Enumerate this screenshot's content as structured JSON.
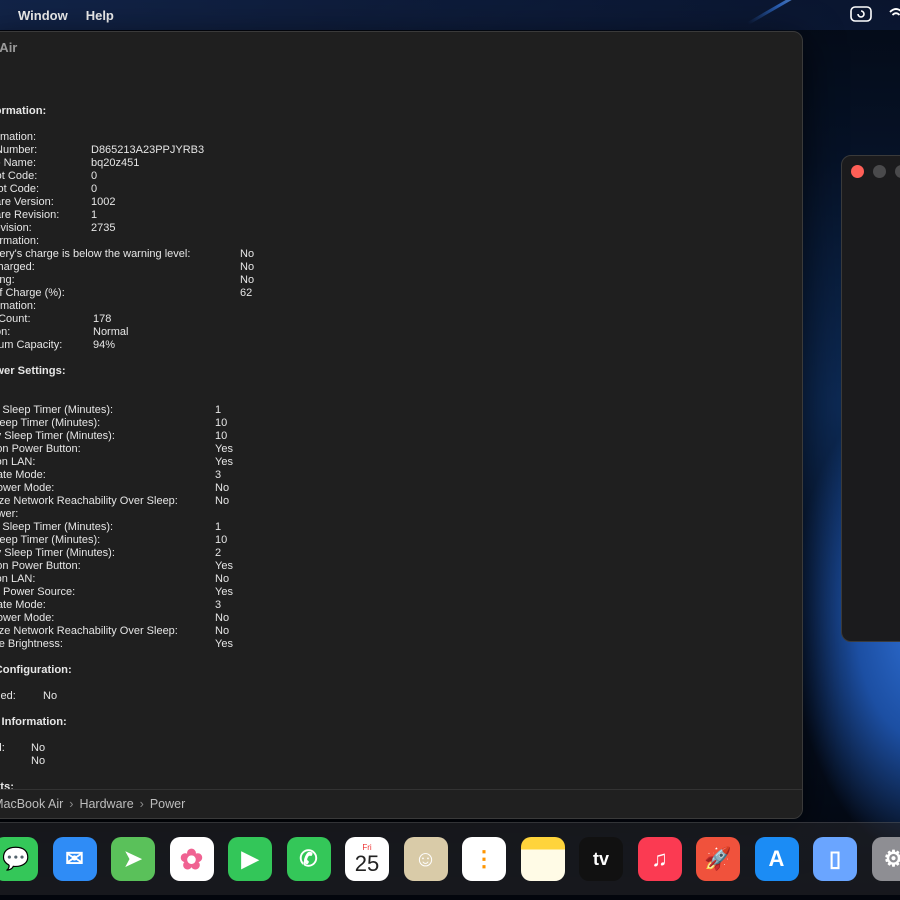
{
  "menubar": {
    "items": [
      "Window",
      "Help"
    ]
  },
  "window": {
    "title": "ok Air",
    "path": [
      "'s MacBook Air",
      "Hardware",
      "Power"
    ]
  },
  "report": {
    "lines": [
      {
        "label": "Information:",
        "value": "",
        "section": true
      },
      {
        "label": "",
        "value": ""
      },
      {
        "label": "nformation:",
        "value": ""
      },
      {
        "label": "ial Number:",
        "value": "D865213A23PPJYRB3",
        "col": 1
      },
      {
        "label": "vice Name:",
        "value": "bq20z451",
        "col": 1
      },
      {
        "label": "k Lot Code:",
        "value": "0",
        "col": 1
      },
      {
        "label": "B Lot Code:",
        "value": "0",
        "col": 1
      },
      {
        "label": "nware Version:",
        "value": "1002",
        "col": 1
      },
      {
        "label": "dware Revision:",
        "value": "1",
        "col": 1
      },
      {
        "label": "l Revision:",
        "value": "2735",
        "col": 1
      },
      {
        "label": "Information:",
        "value": ""
      },
      {
        "label": "battery's charge is below the warning level:",
        "value": "No",
        "col": 3
      },
      {
        "label": "y Charged:",
        "value": "No",
        "col": 3
      },
      {
        "label": "arging:",
        "value": "No",
        "col": 3
      },
      {
        "label": "te of Charge (%):",
        "value": "62",
        "col": 3
      },
      {
        "label": "nformation:",
        "value": ""
      },
      {
        "label": "cle Count:",
        "value": "178",
        "col": 2
      },
      {
        "label": "dition:",
        "value": "Normal",
        "col": 2
      },
      {
        "label": "ximum Capacity:",
        "value": "94%",
        "col": 2
      },
      {
        "label": "",
        "value": ""
      },
      {
        "label": "Power Settings:",
        "value": "",
        "section": true
      },
      {
        "label": "",
        "value": ""
      },
      {
        "label": "ver:",
        "value": ""
      },
      {
        "label": "tem Sleep Timer (Minutes):",
        "value": "1",
        "col": 4
      },
      {
        "label": "k Sleep Timer (Minutes):",
        "value": "10",
        "col": 4
      },
      {
        "label": "play Sleep Timer (Minutes):",
        "value": "10",
        "col": 4
      },
      {
        "label": "ep on Power Button:",
        "value": "Yes",
        "col": 4
      },
      {
        "label": "ke on LAN:",
        "value": "Yes",
        "col": 4
      },
      {
        "label": "ernate Mode:",
        "value": "3",
        "col": 4
      },
      {
        "label": "v Power Mode:",
        "value": "No",
        "col": 4
      },
      {
        "label": "oritize Network Reachability Over Sleep:",
        "value": "No",
        "col": 4
      },
      {
        "label": " Power:",
        "value": ""
      },
      {
        "label": "tem Sleep Timer (Minutes):",
        "value": "1",
        "col": 4
      },
      {
        "label": "k Sleep Timer (Minutes):",
        "value": "10",
        "col": 4
      },
      {
        "label": "play Sleep Timer (Minutes):",
        "value": "2",
        "col": 4
      },
      {
        "label": "ep on Power Button:",
        "value": "Yes",
        "col": 4
      },
      {
        "label": "ke on LAN:",
        "value": "No",
        "col": 4
      },
      {
        "label": "rent Power Source:",
        "value": "Yes",
        "col": 4
      },
      {
        "label": "ernate Mode:",
        "value": "3",
        "col": 4
      },
      {
        "label": "v Power Mode:",
        "value": "No",
        "col": 4
      },
      {
        "label": "oritize Network Reachability Over Sleep:",
        "value": "No",
        "col": 4
      },
      {
        "label": "duce Brightness:",
        "value": "Yes",
        "col": 4
      },
      {
        "label": "",
        "value": ""
      },
      {
        "label": "re Configuration:",
        "value": "",
        "section": true
      },
      {
        "label": "",
        "value": ""
      },
      {
        "label": "stalled:",
        "value": "No",
        "col": 5
      },
      {
        "label": "",
        "value": ""
      },
      {
        "label": "ger Information:",
        "value": "",
        "section": true
      },
      {
        "label": "",
        "value": ""
      },
      {
        "label": "cted:",
        "value": "No",
        "col": 6
      },
      {
        "label": "g:",
        "value": "No",
        "col": 6
      },
      {
        "label": "",
        "value": ""
      },
      {
        "label": "vents:",
        "value": "",
        "section": true
      }
    ]
  },
  "dock": {
    "calendar": {
      "month": "Fri",
      "day": "25"
    },
    "apps": [
      {
        "name": "messages-app",
        "icon": "messages-icon",
        "color": "#34c759"
      },
      {
        "name": "mail-app",
        "icon": "mail-icon",
        "color": "#2f8cf6"
      },
      {
        "name": "maps-app",
        "icon": "maps-icon",
        "color": "#5ac15a"
      },
      {
        "name": "photos-app",
        "icon": "photos-icon",
        "color": "#ffffff"
      },
      {
        "name": "facetime-app",
        "icon": "facetime-icon",
        "color": "#33c659"
      },
      {
        "name": "phone-app",
        "icon": "phone-icon",
        "color": "#34c759"
      },
      {
        "name": "calendar-app",
        "icon": "calendar-icon",
        "color": "#ffffff"
      },
      {
        "name": "contacts-app",
        "icon": "contacts-icon",
        "color": "#d9cba8"
      },
      {
        "name": "reminders-app",
        "icon": "reminders-icon",
        "color": "#ffffff"
      },
      {
        "name": "notes-app",
        "icon": "notes-icon",
        "color": "#ffe066"
      },
      {
        "name": "tv-app",
        "icon": "tv-icon",
        "color": "#111111"
      },
      {
        "name": "music-app",
        "icon": "music-icon",
        "color": "#fb3a52"
      },
      {
        "name": "launchpad-app",
        "icon": "rocket-icon",
        "color": "#f0523c"
      },
      {
        "name": "appstore-app",
        "icon": "appstore-icon",
        "color": "#1b8cf5"
      },
      {
        "name": "iphone-mirroring-app",
        "icon": "iphone-mirroring-icon",
        "color": "#6aa5ff"
      },
      {
        "name": "system-settings-app",
        "icon": "gear-icon",
        "color": "#8e8e93"
      }
    ],
    "tv_label": "tv"
  }
}
